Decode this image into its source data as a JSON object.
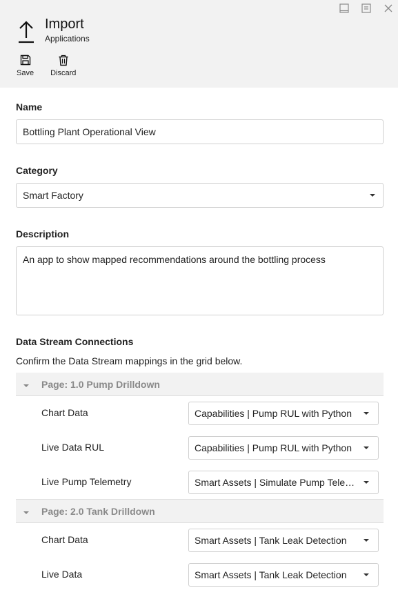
{
  "header": {
    "title": "Import",
    "subtitle": "Applications",
    "toolbar": {
      "save_label": "Save",
      "discard_label": "Discard"
    }
  },
  "form": {
    "name_label": "Name",
    "name_value": "Bottling Plant Operational View",
    "category_label": "Category",
    "category_value": "Smart Factory",
    "description_label": "Description",
    "description_value": "An app to show mapped recommendations around the bottling process"
  },
  "connections": {
    "heading": "Data Stream Connections",
    "hint": "Confirm the Data Stream mappings in the grid below.",
    "groups": [
      {
        "title": "Page: 1.0 Pump Drilldown",
        "rows": [
          {
            "label": "Chart Data",
            "value": "Capabilities | Pump RUL with Python"
          },
          {
            "label": "Live Data RUL",
            "value": "Capabilities | Pump RUL with Python"
          },
          {
            "label": "Live Pump Telemetry",
            "value": "Smart Assets | Simulate Pump Telemetry"
          }
        ]
      },
      {
        "title": "Page: 2.0 Tank Drilldown",
        "rows": [
          {
            "label": "Chart Data",
            "value": "Smart Assets | Tank Leak Detection"
          },
          {
            "label": "Live Data",
            "value": "Smart Assets | Tank Leak Detection"
          }
        ]
      }
    ]
  },
  "icons": {
    "minimize": "minimize-icon",
    "restore": "restore-icon",
    "close": "close-icon",
    "upload": "upload-icon",
    "save": "save-icon",
    "discard": "trash-icon"
  }
}
